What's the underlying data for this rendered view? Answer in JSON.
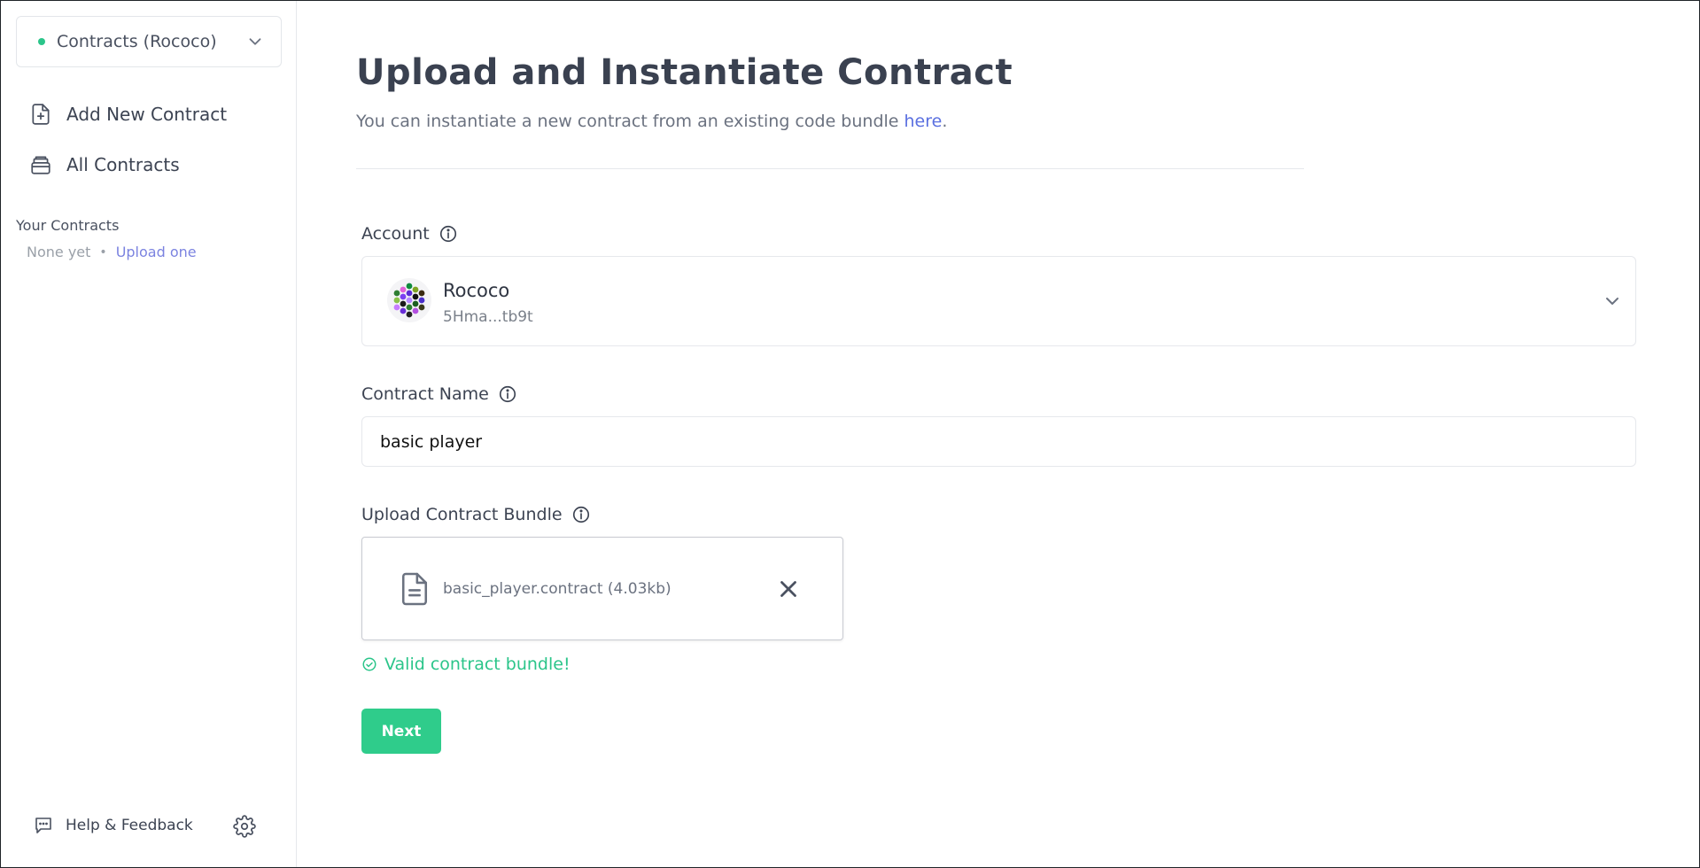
{
  "sidebar": {
    "network_label": "Contracts (Rococo)",
    "nav": {
      "add_new": "Add New Contract",
      "all": "All Contracts"
    },
    "your_contracts": {
      "title": "Your Contracts",
      "empty_text": "None yet",
      "separator": "•",
      "upload_link": "Upload one"
    },
    "help_label": "Help & Feedback"
  },
  "main": {
    "title": "Upload and Instantiate Contract",
    "subtitle_prefix": "You can instantiate a new contract from an existing code bundle ",
    "subtitle_link": "here",
    "subtitle_suffix": ".",
    "account": {
      "label": "Account",
      "name": "Rococo",
      "address": "5Hma...tb9t"
    },
    "contract_name": {
      "label": "Contract Name",
      "value": "basic player"
    },
    "bundle": {
      "label": "Upload Contract Bundle",
      "file": "basic_player.contract (4.03kb)",
      "status": "Valid contract bundle!"
    },
    "next_label": "Next"
  },
  "colors": {
    "accent_green": "#2fcc8b",
    "link_blue": "#5b70e0",
    "status_dot": "#2bc58a"
  },
  "icons": [
    "chevron-down-icon",
    "file-plus-icon",
    "archive-icon",
    "info-icon",
    "file-text-icon",
    "close-icon",
    "check-circle-icon",
    "chat-icon",
    "gear-icon"
  ]
}
